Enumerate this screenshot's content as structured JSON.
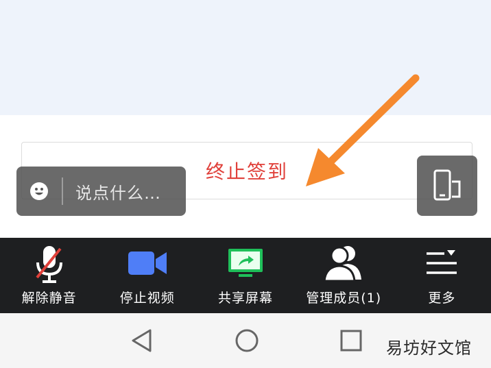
{
  "main": {
    "end_signin_label": "终止签到"
  },
  "chat": {
    "placeholder": "说点什么…",
    "emoji_icon": "smile-icon"
  },
  "rotate": {
    "icon": "rotate-screen-icon"
  },
  "toolbar": {
    "items": [
      {
        "label": "解除静音",
        "icon": "mic-muted-icon"
      },
      {
        "label": "停止视频",
        "icon": "video-camera-icon"
      },
      {
        "label": "共享屏幕",
        "icon": "share-screen-icon"
      },
      {
        "label": "管理成员(1)",
        "icon": "members-icon"
      },
      {
        "label": "更多",
        "icon": "more-menu-icon"
      }
    ]
  },
  "navbar": {
    "back_icon": "back-icon",
    "home_icon": "home-icon",
    "recents_icon": "recents-icon"
  },
  "watermark": "易坊好文馆",
  "colors": {
    "accent_red": "#e0403a",
    "arrow_orange": "#f5892e",
    "video_blue": "#4f7ef7",
    "share_green": "#1fbf5a",
    "toolbar_bg": "#1e1f21"
  }
}
